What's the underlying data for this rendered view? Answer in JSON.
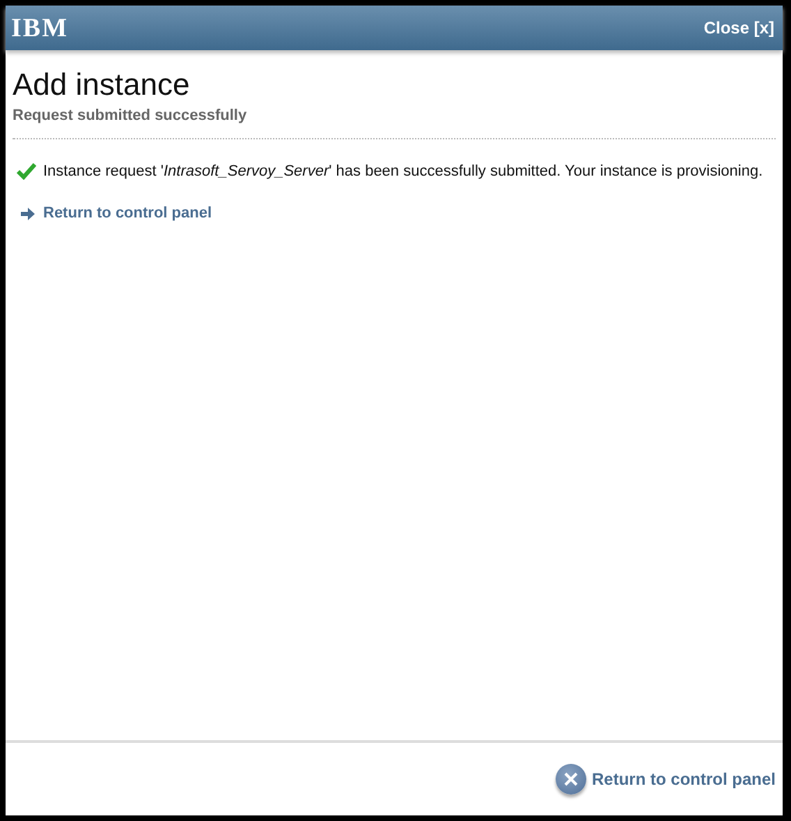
{
  "header": {
    "logo": "IBM",
    "close": "Close [x]"
  },
  "title": "Add instance",
  "subtitle": "Request submitted successfully",
  "message": {
    "kind": "success",
    "text": "Instance request '*Intrasoft_Servoy_Server*' has been successfully submitted. Your instance is provisioning."
  },
  "link": "Return to control panel",
  "footer": {
    "button": "Return to control panel"
  }
}
